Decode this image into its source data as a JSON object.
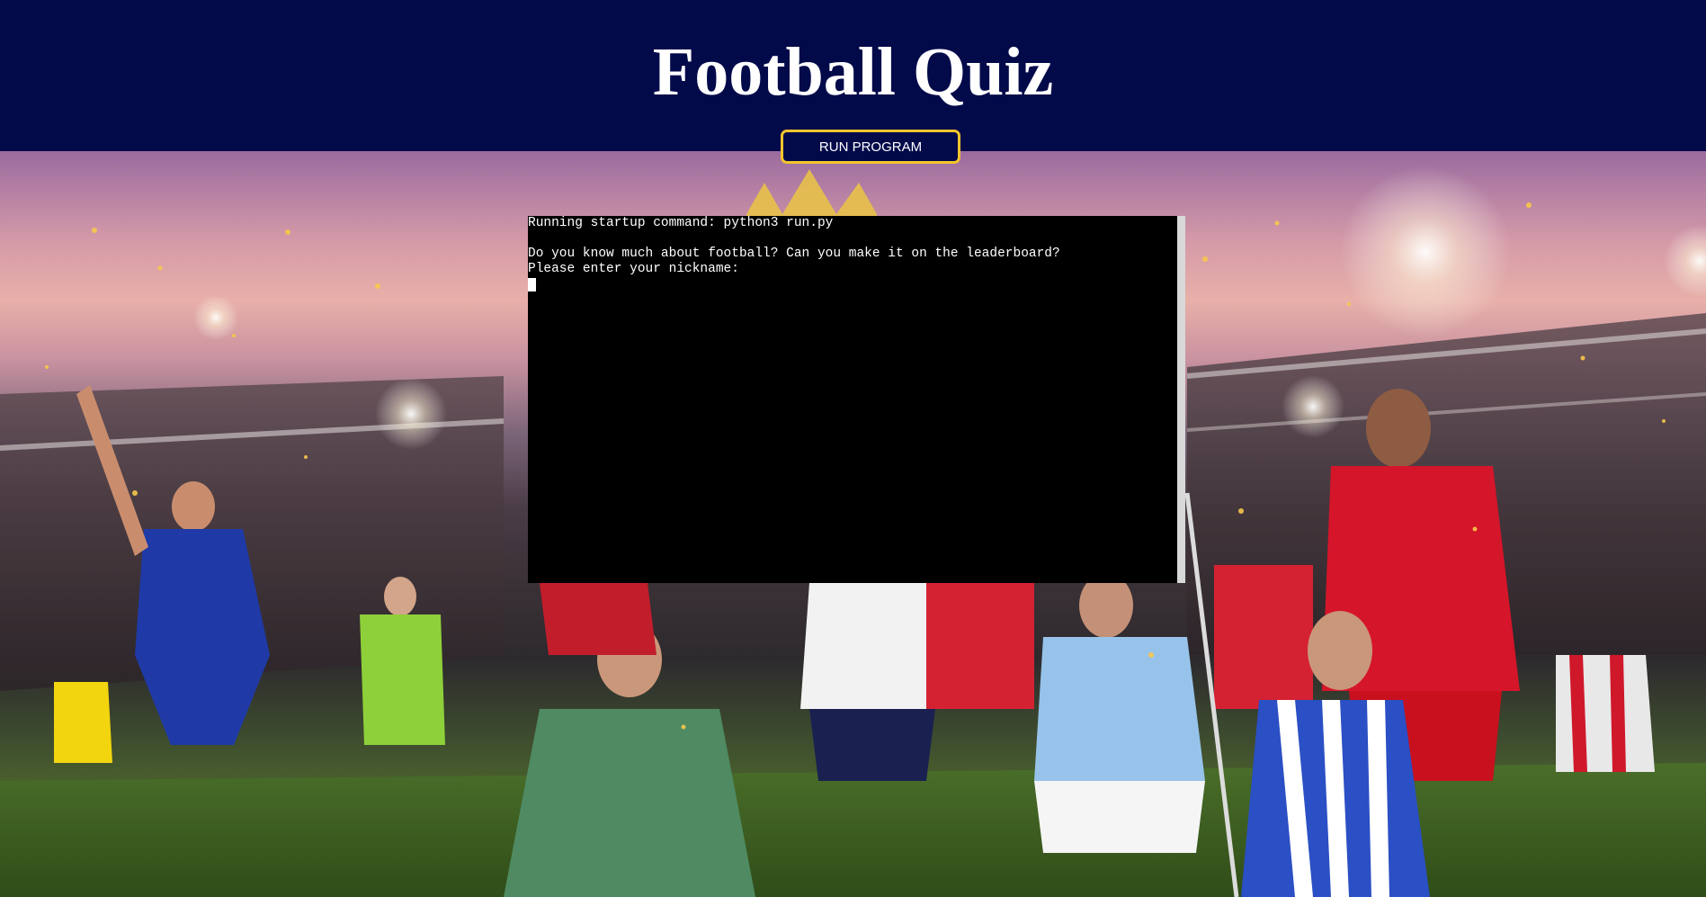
{
  "header": {
    "title": "Football Quiz",
    "run_button_label": "RUN PROGRAM"
  },
  "terminal": {
    "lines": [
      "Running startup command: python3 run.py",
      "",
      "Do you know much about football? Can you make it on the leaderboard?",
      "Please enter your nickname:"
    ]
  },
  "colors": {
    "header_background": "#030a4a",
    "button_border": "#f2c52c",
    "terminal_background": "#000000",
    "terminal_text": "#ffffff"
  }
}
